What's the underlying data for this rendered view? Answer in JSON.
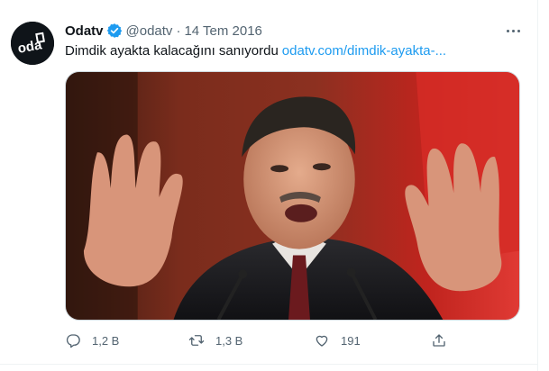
{
  "tweet": {
    "display_name": "Odatv",
    "handle": "@odatv",
    "separator": "·",
    "date": "14 Tem 2016",
    "text": "Dimdik ayakta kalacağını sanıyordu",
    "link_text": "odatv.com/dimdik-ayakta-..."
  },
  "avatar": {
    "logo_text": "odatv"
  },
  "actions": {
    "reply_count": "1,2 B",
    "retweet_count": "1,3 B",
    "like_count": "191"
  },
  "colors": {
    "link": "#1d9bf0",
    "secondary_text": "#536471",
    "verified": "#1d9bf0",
    "divider": "#eff3f4"
  }
}
